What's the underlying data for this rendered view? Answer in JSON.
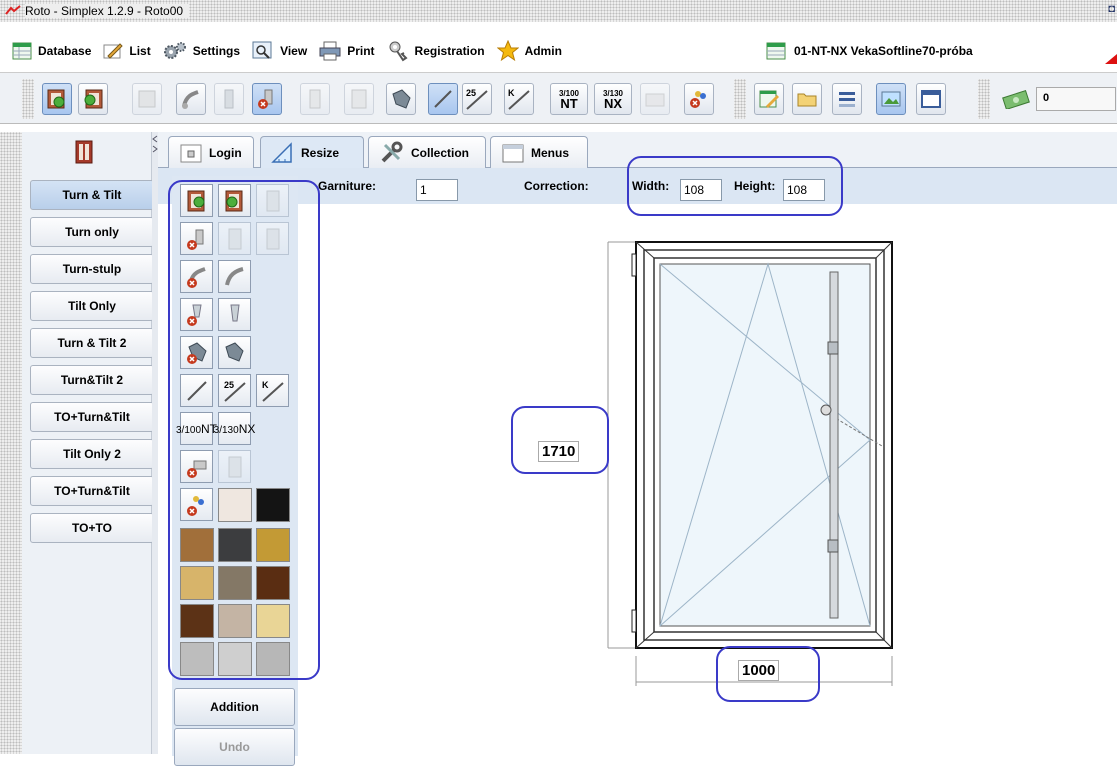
{
  "window": {
    "title": "Roto - Simplex 1.2.9  - Roto00"
  },
  "menu": {
    "items": [
      {
        "id": "database",
        "label": "Database"
      },
      {
        "id": "list",
        "label": "List"
      },
      {
        "id": "settings",
        "label": "Settings"
      },
      {
        "id": "view",
        "label": "View"
      },
      {
        "id": "print",
        "label": "Print"
      },
      {
        "id": "registration",
        "label": "Registration"
      },
      {
        "id": "admin",
        "label": "Admin"
      }
    ],
    "project": "01-NT-NX VekaSoftline70-próba"
  },
  "toolbar": {
    "labels": {
      "n25": "25",
      "k": "K",
      "nt_top": "3/100",
      "nt": "NT",
      "nx_top": "3/130",
      "nx": "NX"
    },
    "counter": "0"
  },
  "types": [
    "Turn & Tilt",
    "Turn only",
    "Turn-stulp",
    "Tilt Only",
    "Turn & Tilt 2",
    "Turn&Tilt 2",
    "TO+Turn&Tilt",
    "Tilt Only 2",
    "TO+Turn&Tilt",
    "TO+TO"
  ],
  "tabs": [
    "Login",
    "Resize",
    "Collection",
    "Menus"
  ],
  "resize": {
    "garniture_label": "Garniture:",
    "garniture": "1",
    "correction_label": "Correction:",
    "width_label": "Width:",
    "width": "108",
    "height_label": "Height:",
    "height": "108"
  },
  "panel": {
    "labels": {
      "n25": "25",
      "k": "K",
      "nt_top": "3/100",
      "nt": "NT",
      "nx_top": "3/130",
      "nx": "NX"
    },
    "addition": "Addition",
    "undo": "Undo",
    "swatch_colors": [
      "#efe7e0",
      "#141414",
      "#a16f3a",
      "#3c3d3f",
      "#c39a35",
      "#d7b46a",
      "#847866",
      "#5a2d12",
      "#5c3216",
      "#c4b4a4",
      "#e9d596",
      "#bdbdbd",
      "#cfcfcf",
      "#b7b7b7"
    ]
  },
  "dimensions": {
    "height": "1710",
    "width": "1000"
  }
}
